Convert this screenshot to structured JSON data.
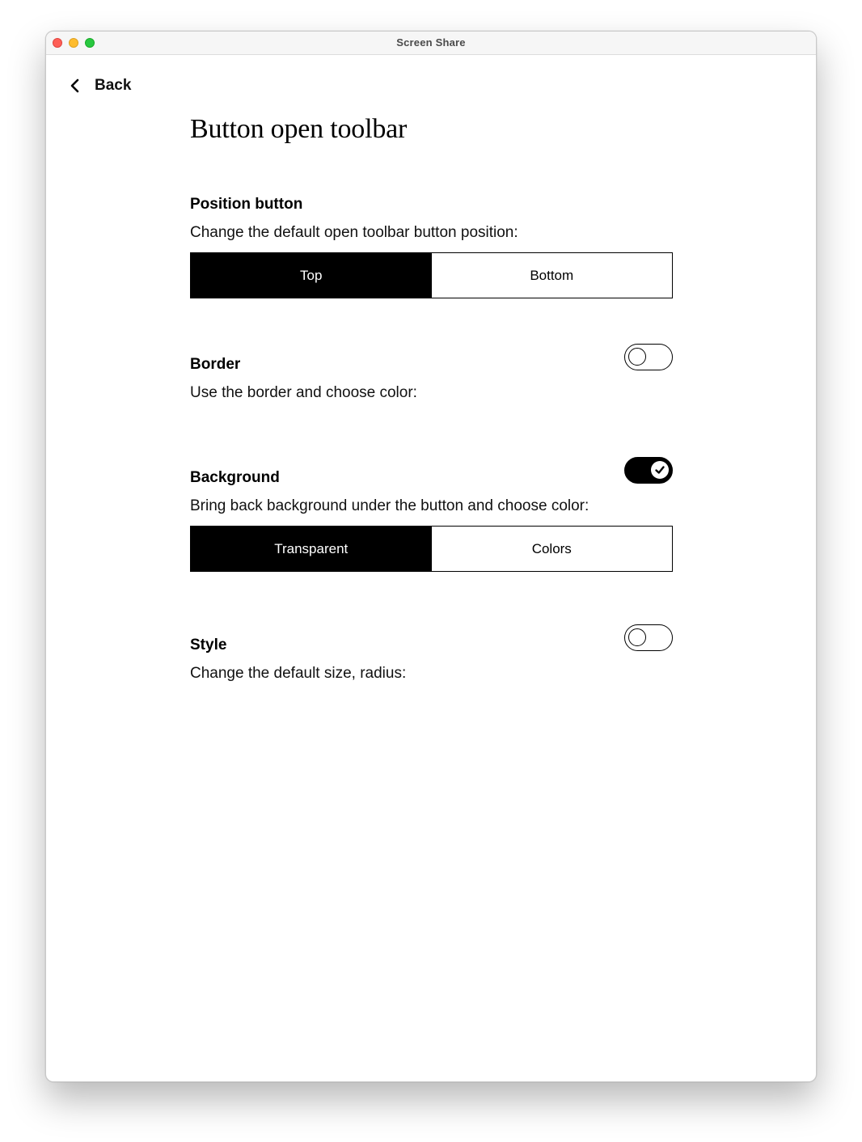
{
  "window": {
    "title": "Screen Share"
  },
  "nav": {
    "back_label": "Back",
    "back_icon": "chevron-left-icon"
  },
  "page": {
    "title": "Button open toolbar"
  },
  "sections": {
    "position": {
      "title": "Position button",
      "description": "Change the default open toolbar button position:",
      "options": [
        "Top",
        "Bottom"
      ],
      "selected": "Top"
    },
    "border": {
      "title": "Border",
      "description": "Use the border and choose color:",
      "enabled": false
    },
    "background": {
      "title": "Background",
      "description": "Bring back background under the button and choose color:",
      "enabled": true,
      "options": [
        "Transparent",
        "Colors"
      ],
      "selected": "Transparent"
    },
    "style": {
      "title": "Style",
      "description": "Change the default size, radius:",
      "enabled": false
    }
  },
  "colors": {
    "close": "#fe5f57",
    "minimize": "#febc2e",
    "maximize": "#28c840",
    "accent": "#000000"
  }
}
